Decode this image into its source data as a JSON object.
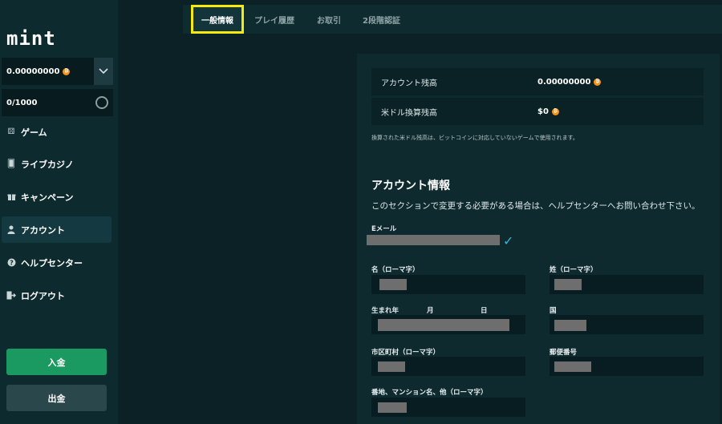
{
  "sidebar": {
    "logo": "mint",
    "wallet_amount": "0.00000000",
    "xp_progress": "0/1000",
    "nav": [
      {
        "label": "ゲーム",
        "icon": "dice-icon"
      },
      {
        "label": "ライブカジノ",
        "icon": "cards-icon"
      },
      {
        "label": "キャンペーン",
        "icon": "gift-icon"
      },
      {
        "label": "アカウント",
        "icon": "user-icon"
      },
      {
        "label": "ヘルプセンター",
        "icon": "help-icon"
      },
      {
        "label": "ログアウト",
        "icon": "logout-icon"
      }
    ],
    "deposit_label": "入金",
    "withdraw_label": "出金"
  },
  "tabs": [
    {
      "label": "一般情報",
      "active": true
    },
    {
      "label": "プレイ履歴",
      "active": false
    },
    {
      "label": "お取引",
      "active": false
    },
    {
      "label": "2段階認証",
      "active": false
    }
  ],
  "balance": {
    "account_label": "アカウント残高",
    "account_value": "0.00000000",
    "usd_label": "米ドル換算残高",
    "usd_value": "$0",
    "note": "換算された米ドル残高は、ビットコインに対応していないゲームで使用されます。"
  },
  "account_info": {
    "title": "アカウント情報",
    "description": "このセクションで変更する必要がある場合は、ヘルプセンターへお問い合わせ下さい。",
    "email_label": "Eメール",
    "first_name_label": "名（ローマ字）",
    "last_name_label": "姓（ローマ字）",
    "birth_year_label": "生まれ年",
    "birth_month_label": "月",
    "birth_day_label": "日",
    "country_label": "国",
    "city_label": "市区町村（ローマ字）",
    "postal_label": "郵便番号",
    "address_label": "番地、マンション名、他（ローマ字）"
  },
  "colors": {
    "accent_green": "#1a9a60",
    "highlight_yellow": "#f4ea10",
    "bitcoin_orange": "#f7931a",
    "verified_blue": "#37b6d6"
  }
}
